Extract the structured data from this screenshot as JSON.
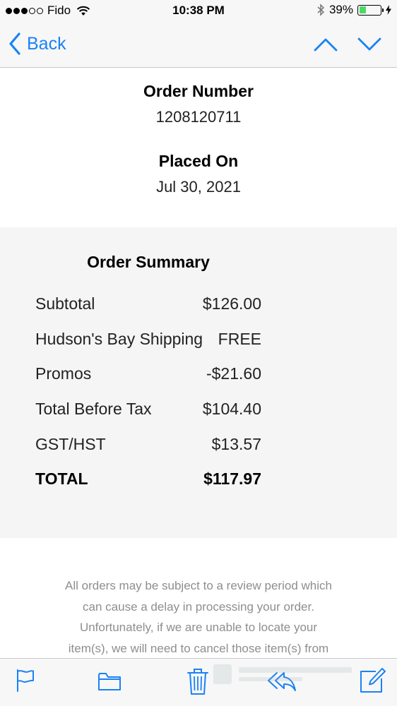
{
  "status_bar": {
    "carrier": "Fido",
    "time": "10:38 PM",
    "battery_percent": "39%",
    "battery_level": 0.39
  },
  "nav": {
    "back_label": "Back"
  },
  "order": {
    "number_label": "Order Number",
    "number_value": "1208120711",
    "placed_label": "Placed On",
    "placed_value": "Jul 30, 2021"
  },
  "summary": {
    "title": "Order Summary",
    "rows": [
      {
        "label": "Subtotal",
        "value": "$126.00"
      },
      {
        "label": "Hudson's Bay Shipping",
        "value": "FREE"
      },
      {
        "label": "Promos",
        "value": "-$21.60"
      },
      {
        "label": "Total Before Tax",
        "value": "$104.40"
      },
      {
        "label": "GST/HST",
        "value": "$13.57"
      },
      {
        "label": "TOTAL",
        "value": "$117.97"
      }
    ]
  },
  "disclaimer": {
    "lines": [
      "All orders may be subject to a review period which",
      "can cause a delay in processing your order.",
      "Unfortunately, if we are unable to locate your",
      "item(s), we will need to cancel those item(s) from"
    ]
  },
  "colors": {
    "accent": "#1a82f5",
    "battery_green": "#4cd964",
    "muted_text": "#8e8e93",
    "summary_bg": "#f5f5f6"
  },
  "toolbar": {
    "icons": [
      "flag-icon",
      "folder-icon",
      "trash-icon",
      "reply-icon",
      "compose-icon"
    ]
  }
}
